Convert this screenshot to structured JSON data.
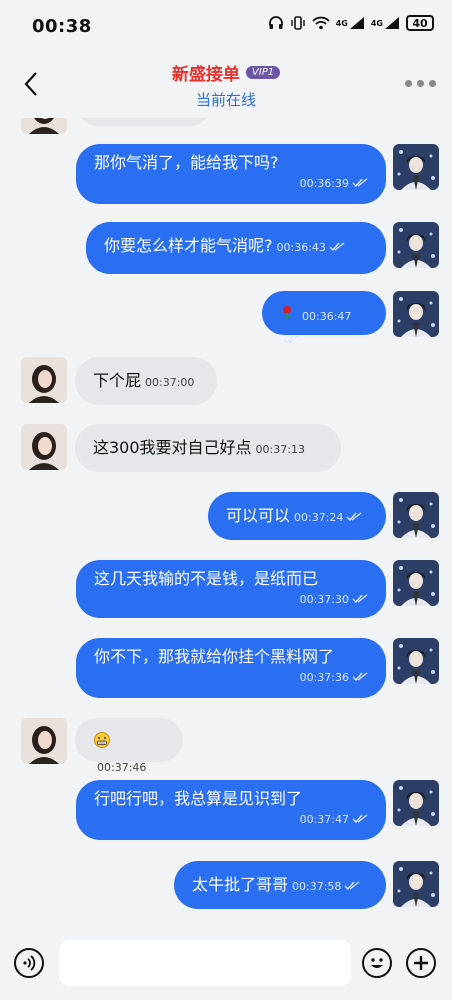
{
  "status_bar": {
    "time": "00:38",
    "network_a": "4G",
    "network_b": "4G",
    "battery": "40"
  },
  "header": {
    "title": "新盛接单",
    "vip": "VIP1",
    "subtitle": "当前在线"
  },
  "messages": [
    {
      "sender": "me",
      "text": "那你气消了，能给我下吗?",
      "time": "00:36:39",
      "read": true
    },
    {
      "sender": "me",
      "text": "你要怎么样才能气消呢?",
      "time": "00:36:43",
      "read": true
    },
    {
      "sender": "me",
      "text": "",
      "emoji": "rose-icon",
      "time": "00:36:47",
      "read": true
    },
    {
      "sender": "other",
      "text": "下个屁",
      "time": "00:37:00"
    },
    {
      "sender": "other",
      "text": "这300我要对自己好点",
      "time": "00:37:13"
    },
    {
      "sender": "me",
      "text": "可以可以",
      "time": "00:37:24",
      "read": true
    },
    {
      "sender": "me",
      "text": "这几天我输的不是钱，是纸而已",
      "time": "00:37:30",
      "read": true
    },
    {
      "sender": "me",
      "text": "你不下，那我就给你挂个黑料网了",
      "time": "00:37:36",
      "read": true
    },
    {
      "sender": "other",
      "text": "",
      "emoji": "grimace-icon",
      "time": "00:37:46"
    },
    {
      "sender": "me",
      "text": "行吧行吧，我总算是见识到了",
      "time": "00:37:47",
      "read": true
    },
    {
      "sender": "me",
      "text": "太牛批了哥哥",
      "time": "00:37:58",
      "read": true
    }
  ],
  "input": {
    "placeholder": ""
  },
  "colors": {
    "my_bubble": "#2a6ff2",
    "other_bubble": "#e6e7ea",
    "title": "#e5322d",
    "online": "#2f6fe0"
  }
}
